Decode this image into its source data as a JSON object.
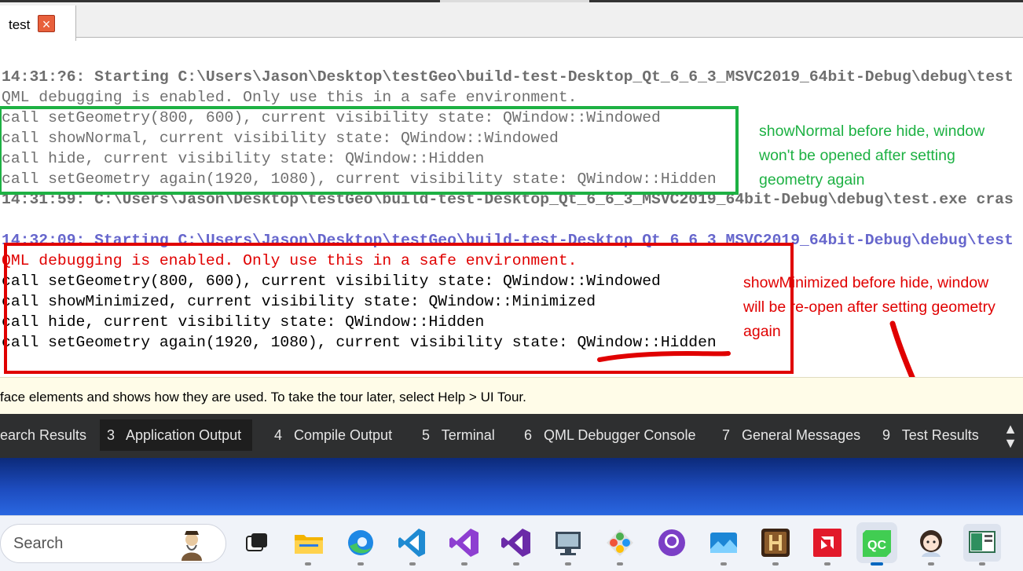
{
  "editor_tab": {
    "label": "test",
    "close_symbol": "×"
  },
  "output": {
    "run1_start_time": "14:31:?6:",
    "run1_start_msg": " Starting C:\\Users\\Jason\\Desktop\\testGeo\\build-test-Desktop_Qt_6_6_3_MSVC2019_64bit-Debug\\debug\\test",
    "run1_lines": [
      "QML debugging is enabled. Only use this in a safe environment.",
      "call setGeometry(800, 600), current visibility state: QWindow::Windowed",
      "call showNormal, current visibility state: QWindow::Windowed",
      "call hide, current visibility state: QWindow::Hidden",
      "call setGeometry again(1920, 1080), current visibility state: QWindow::Hidden"
    ],
    "run1_end_time": "14:31:59:",
    "run1_end_msg": " C:\\Users\\Jason\\Desktop\\testGeo\\build-test-Desktop_Qt_6_6_3_MSVC2019_64bit-Debug\\debug\\test.exe cras",
    "run2_start_time": "14:32:09:",
    "run2_start_msg": " Starting C:\\Users\\Jason\\Desktop\\testGeo\\build-test-Desktop_Qt_6_6_3_MSVC2019_64bit-Debug\\debug\\test",
    "run2_lines": [
      "QML debugging is enabled. Only use this in a safe environment.",
      "call setGeometry(800, 600), current visibility state: QWindow::Windowed",
      "call showMinimized, current visibility state: QWindow::Minimized",
      "call hide, current visibility state: QWindow::Hidden",
      "call setGeometry again(1920, 1080), current visibility state: QWindow::Hidden"
    ]
  },
  "annotations": {
    "green_note": "showNormal before hide, window\nwon't be opened after setting\ngeometry again",
    "red_note": "showMinimized before hide, window\nwill be re-open after setting geometry\nagain",
    "green_color": "#1db143",
    "red_color": "#e00000"
  },
  "tip_bar": {
    "text": "face elements and shows how they are used. To take the tour later, select Help > UI Tour."
  },
  "output_panes": [
    {
      "label": "earch Results",
      "active": false
    },
    {
      "label": "3   Application Output",
      "active": true
    },
    {
      "label": "4   Compile Output",
      "active": false
    },
    {
      "label": "5   Terminal",
      "active": false
    },
    {
      "label": "6   QML Debugger Console",
      "active": false
    },
    {
      "label": "7   General Messages",
      "active": false
    },
    {
      "label": "9   Test Results",
      "active": false
    }
  ],
  "pane_scroll_icon": "up-down-arrows-icon",
  "taskbar": {
    "search_placeholder": "Search",
    "apps": [
      "task-view",
      "file-explorer",
      "edge",
      "vs-code",
      "visual-studio",
      "visual-studio-2",
      "remote-desktop",
      "git-extensions",
      "github-desktop",
      "photos",
      "game",
      "amd-software",
      "qt-creator",
      "avatar-app",
      "test-app"
    ],
    "qt_creator_label": "QC"
  }
}
